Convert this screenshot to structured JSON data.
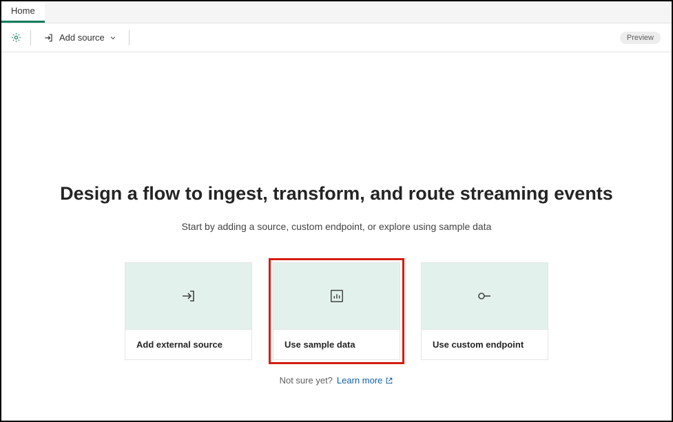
{
  "tabs": {
    "home": "Home"
  },
  "toolbar": {
    "add_source_label": "Add source",
    "preview_label": "Preview"
  },
  "main": {
    "heading": "Design a flow to ingest, transform, and route streaming events",
    "subheading": "Start by adding a source, custom endpoint, or explore using sample data"
  },
  "cards": {
    "external": {
      "label": "Add external source"
    },
    "sample": {
      "label": "Use sample data"
    },
    "endpoint": {
      "label": "Use custom endpoint"
    }
  },
  "footer": {
    "not_sure": "Not sure yet?",
    "learn_more": "Learn more"
  }
}
